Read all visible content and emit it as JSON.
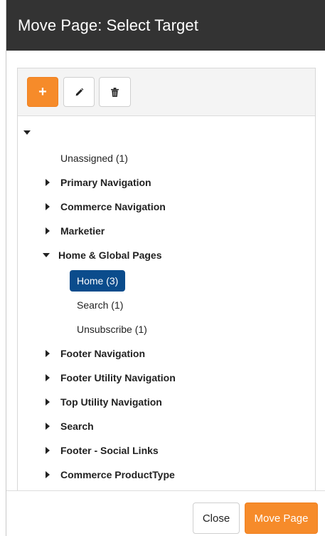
{
  "modal": {
    "title": "Move Page: Select Target",
    "accent_color": "#f68b2a",
    "selected_color": "#0b4c8c"
  },
  "toolbar": {
    "add_icon": "plus-icon",
    "edit_icon": "pencil-icon",
    "delete_icon": "trash-icon"
  },
  "tree": {
    "root_expanded": true,
    "items": [
      {
        "label": "Unassigned (1)",
        "level": 1,
        "expandable": false,
        "expanded": false,
        "bold": false
      },
      {
        "label": "Primary Navigation",
        "level": 1,
        "expandable": true,
        "expanded": false,
        "bold": true
      },
      {
        "label": "Commerce Navigation",
        "level": 1,
        "expandable": true,
        "expanded": false,
        "bold": true
      },
      {
        "label": "Marketier",
        "level": 1,
        "expandable": true,
        "expanded": false,
        "bold": true
      },
      {
        "label": "Home & Global Pages",
        "level": 1,
        "expandable": true,
        "expanded": true,
        "bold": true
      },
      {
        "label": "Home (3)",
        "level": 2,
        "expandable": false,
        "expanded": false,
        "bold": false,
        "selected": true
      },
      {
        "label": "Search (1)",
        "level": 2,
        "expandable": false,
        "expanded": false,
        "bold": false
      },
      {
        "label": "Unsubscribe (1)",
        "level": 2,
        "expandable": false,
        "expanded": false,
        "bold": false
      },
      {
        "label": "Footer Navigation",
        "level": 1,
        "expandable": true,
        "expanded": false,
        "bold": true
      },
      {
        "label": "Footer Utility Navigation",
        "level": 1,
        "expandable": true,
        "expanded": false,
        "bold": true
      },
      {
        "label": "Top Utility Navigation",
        "level": 1,
        "expandable": true,
        "expanded": false,
        "bold": true
      },
      {
        "label": "Search",
        "level": 1,
        "expandable": true,
        "expanded": false,
        "bold": true
      },
      {
        "label": "Footer - Social Links",
        "level": 1,
        "expandable": true,
        "expanded": false,
        "bold": true
      },
      {
        "label": "Commerce ProductType",
        "level": 1,
        "expandable": true,
        "expanded": false,
        "bold": true
      }
    ]
  },
  "footer": {
    "close_label": "Close",
    "move_label": "Move Page"
  }
}
